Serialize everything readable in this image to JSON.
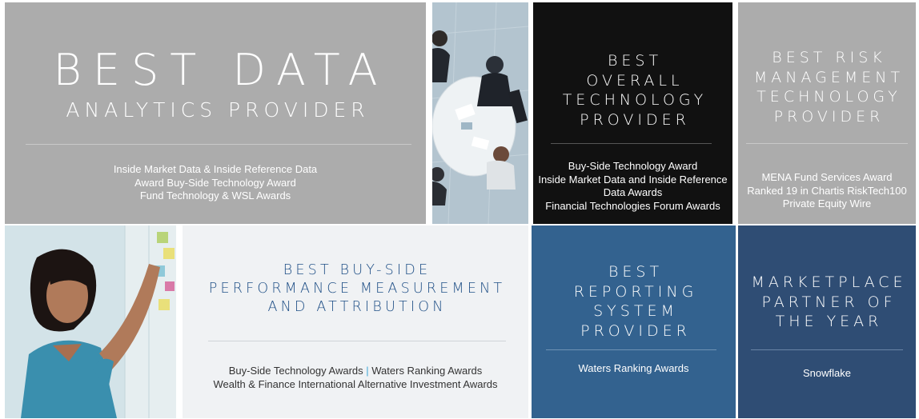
{
  "tiles": {
    "data_analytics": {
      "title_main": "BEST DATA",
      "title_sub": "ANALYTICS PROVIDER",
      "lines": [
        "Inside Market Data & Inside Reference Data",
        "Award Buy-Side Technology Award",
        "Fund Technology & WSL Awards"
      ]
    },
    "overall_technology": {
      "title_lines": [
        "BEST",
        "OVERALL",
        "TECHNOLOGY",
        "PROVIDER"
      ],
      "lines": [
        "Buy-Side Technology Award",
        "Inside Market Data and Inside Reference",
        "Data Awards",
        "Financial Technologies Forum Awards"
      ]
    },
    "risk_management": {
      "title_lines": [
        "BEST RISK",
        "MANAGEMENT",
        "TECHNOLOGY",
        "PROVIDER"
      ],
      "lines": [
        "MENA Fund Services Award",
        "Ranked 19 in Chartis RiskTech100",
        "Private Equity Wire"
      ]
    },
    "performance_measurement": {
      "title_lines": [
        "BEST BUY-SIDE",
        "PERFORMANCE MEASUREMENT",
        "AND ATTRIBUTION"
      ],
      "line1_a": "Buy-Side Technology Awards ",
      "line1_sep": "|",
      "line1_b": " Waters Ranking Awards",
      "line2": "Wealth & Finance International Alternative Investment Awards"
    },
    "reporting_system": {
      "title_lines": [
        "BEST",
        "REPORTING",
        "SYSTEM",
        "PROVIDER"
      ],
      "lines": [
        "Waters Ranking Awards"
      ]
    },
    "marketplace_partner": {
      "title_lines": [
        "MARKETPLACE",
        "PARTNER OF",
        "THE YEAR"
      ],
      "lines": [
        "Snowflake"
      ]
    }
  },
  "photos": {
    "meeting": "overhead view of business meeting around a round table",
    "woman": "woman reviewing sticky notes on a glass wall"
  },
  "colors": {
    "gray_tile": "#acacac",
    "black_tile": "#111111",
    "light_tile": "#f0f2f4",
    "blue_tile": "#33628f",
    "navy_tile": "#2f4d74",
    "title_blue": "#1f4f86",
    "separator": "#3fa7d6"
  }
}
